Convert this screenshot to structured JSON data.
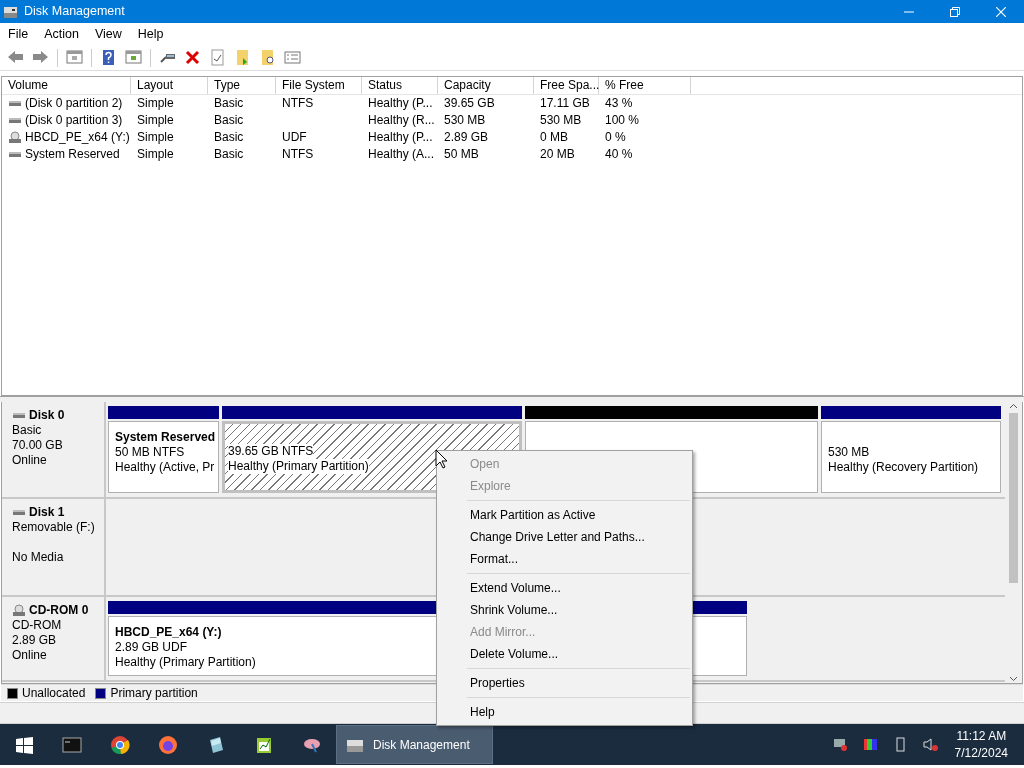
{
  "window": {
    "title": "Disk Management"
  },
  "menu": [
    "File",
    "Action",
    "View",
    "Help"
  ],
  "volumes": {
    "columns": [
      "Volume",
      "Layout",
      "Type",
      "File System",
      "Status",
      "Capacity",
      "Free Spa...",
      "% Free"
    ],
    "rows": [
      {
        "kind": "disk",
        "cells": [
          "(Disk 0 partition 2)",
          "Simple",
          "Basic",
          "NTFS",
          "Healthy (P...",
          "39.65 GB",
          "17.11 GB",
          "43 %"
        ]
      },
      {
        "kind": "disk",
        "cells": [
          "(Disk 0 partition 3)",
          "Simple",
          "Basic",
          "",
          "Healthy (R...",
          "530 MB",
          "530 MB",
          "100 %"
        ]
      },
      {
        "kind": "cdrom",
        "cells": [
          "HBCD_PE_x64 (Y:)",
          "Simple",
          "Basic",
          "UDF",
          "Healthy (P...",
          "2.89 GB",
          "0 MB",
          "0 %"
        ]
      },
      {
        "kind": "disk",
        "cells": [
          "System Reserved",
          "Simple",
          "Basic",
          "NTFS",
          "Healthy (A...",
          "50 MB",
          "20 MB",
          "40 %"
        ]
      }
    ]
  },
  "disks": [
    {
      "kind": "disk",
      "name": "Disk 0",
      "lines": [
        "Basic",
        "70.00 GB"
      ],
      "status": "Online",
      "partitions": [
        {
          "kind": "primary",
          "selected": false,
          "title": "System Reserved",
          "lines": [
            "50 MB NTFS",
            "Healthy (Active, Pr"
          ]
        },
        {
          "kind": "primary",
          "selected": true,
          "lines": [
            "39.65 GB NTFS",
            "Healthy (Primary Partition)"
          ]
        },
        {
          "kind": "unallocated",
          "selected": false
        },
        {
          "kind": "primary",
          "selected": false,
          "lines": [
            "530 MB",
            "Healthy (Recovery Partition)"
          ]
        }
      ]
    },
    {
      "kind": "disk",
      "name": "Disk 1",
      "lines": [
        "Removable (F:)"
      ],
      "status": "No Media"
    },
    {
      "kind": "cdrom",
      "name": "CD-ROM 0",
      "lines": [
        "CD-ROM",
        "2.89 GB"
      ],
      "status": "Online",
      "partitions": [
        {
          "kind": "primary",
          "selected": false,
          "title": "HBCD_PE_x64  (Y:)",
          "lines": [
            "2.89 GB UDF",
            "Healthy (Primary Partition)"
          ]
        }
      ]
    }
  ],
  "legend": [
    {
      "label": "Unallocated",
      "color": "#000000"
    },
    {
      "label": "Primary partition",
      "color": "#000080"
    }
  ],
  "context_menu": [
    [
      {
        "label": "Open",
        "disabled": true
      },
      {
        "label": "Explore",
        "disabled": true
      }
    ],
    [
      {
        "label": "Mark Partition as Active",
        "disabled": false
      },
      {
        "label": "Change Drive Letter and Paths...",
        "disabled": false
      },
      {
        "label": "Format...",
        "disabled": false
      }
    ],
    [
      {
        "label": "Extend Volume...",
        "disabled": false
      },
      {
        "label": "Shrink Volume...",
        "disabled": false
      },
      {
        "label": "Add Mirror...",
        "disabled": true
      },
      {
        "label": "Delete Volume...",
        "disabled": false
      }
    ],
    [
      {
        "label": "Properties",
        "disabled": false
      }
    ],
    [
      {
        "label": "Help",
        "disabled": false
      }
    ]
  ],
  "taskbar": {
    "window_button": {
      "label": "Disk Management",
      "selected": true
    },
    "time": "11:12 AM",
    "date": "7/12/2024"
  }
}
